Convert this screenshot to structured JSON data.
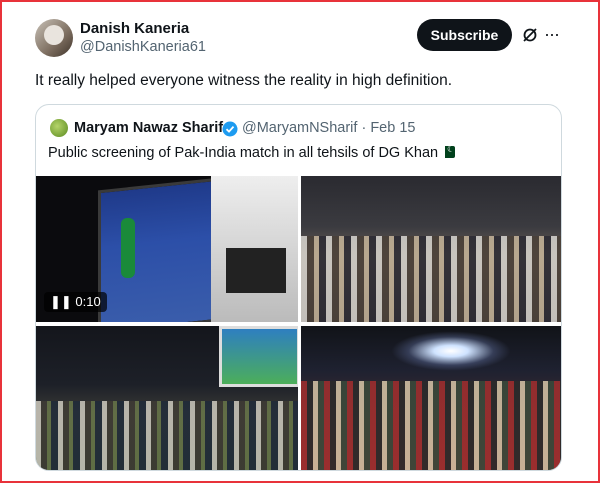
{
  "tweet": {
    "display_name": "Danish Kaneria",
    "handle": "@DanishKaneria61",
    "subscribe_label": "Subscribe",
    "more_label": "···",
    "text": "It really helped everyone witness the reality in high definition."
  },
  "quoted": {
    "display_name": "Maryam Nawaz Sharif",
    "handle_and_date": "@MaryamNSharif · Feb 15",
    "text": "Public screening of Pak-India match in all tehsils of DG Khan",
    "video_time": "❚❚ 0:10"
  },
  "icons": {
    "verified": "verified-badge-icon",
    "grok": "grok-icon",
    "flag": "pakistan-flag-emoji"
  },
  "colors": {
    "border_accent": "#e8323a",
    "verified": "#1d9bf0",
    "subscribe_bg": "#0f1419"
  }
}
